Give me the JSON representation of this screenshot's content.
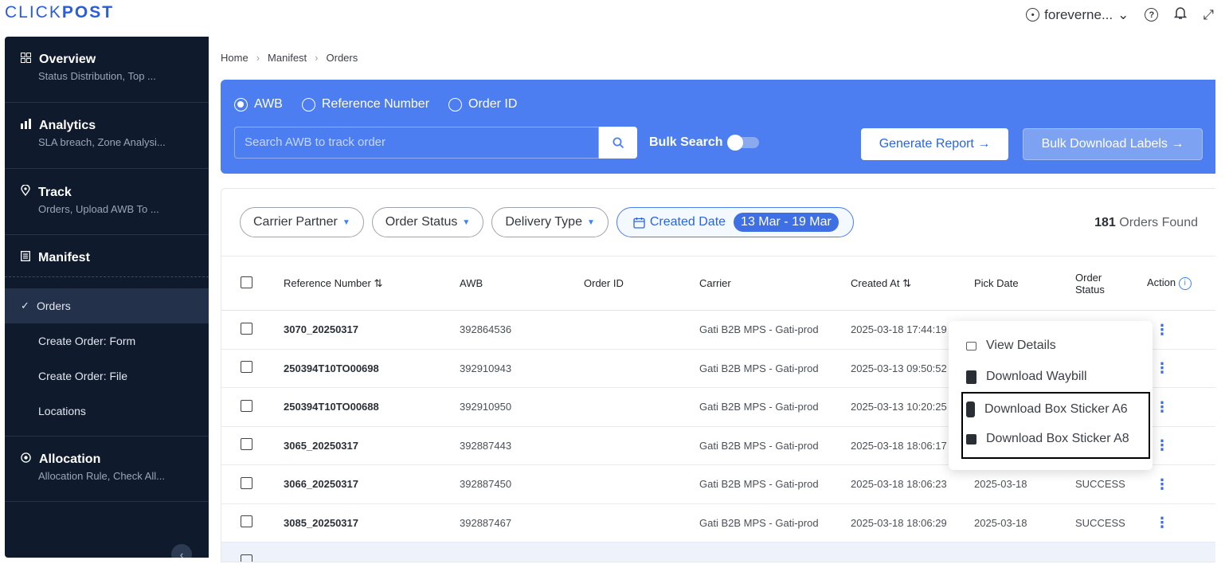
{
  "brand": {
    "part1": "CLICK",
    "part2": "POST"
  },
  "topbar": {
    "username": "foreverne...",
    "caret": "⌄",
    "help": "?",
    "bell": "🔔",
    "expand": "⤢"
  },
  "sidebar": {
    "sections": [
      {
        "title": "Overview",
        "sub": "Status Distribution, Top ..."
      },
      {
        "title": "Analytics",
        "sub": "SLA breach, Zone Analysi..."
      },
      {
        "title": "Track",
        "sub": "Orders, Upload AWB To ..."
      },
      {
        "title": "Manifest"
      },
      {
        "title": "Allocation",
        "sub": "Allocation Rule, Check All..."
      }
    ],
    "subnav": [
      "Orders",
      "Create Order: Form",
      "Create Order: File",
      "Locations"
    ],
    "collapse": "‹"
  },
  "breadcrumb": [
    "Home",
    "Manifest",
    "Orders"
  ],
  "search": {
    "options": [
      "AWB",
      "Reference Number",
      "Order ID"
    ],
    "selected": "AWB",
    "placeholder": "Search AWB to track order",
    "bulk_label": "Bulk Search",
    "generate_label": "Generate Report →",
    "bulk_download_label": "Bulk Download Labels →"
  },
  "filters": {
    "carrier": "Carrier Partner",
    "status": "Order Status",
    "delivery": "Delivery Type",
    "created": "Created Date",
    "date_range": "13 Mar - 19 Mar"
  },
  "found": {
    "count": "181",
    "label": "Orders Found"
  },
  "table": {
    "headers": {
      "ref": "Reference Number",
      "awb": "AWB",
      "order_id": "Order ID",
      "carrier": "Carrier",
      "created": "Created At",
      "pick": "Pick Date",
      "status_l1": "Order",
      "status_l2": "Status",
      "action": "Action"
    },
    "rows": [
      {
        "ref": "3070_20250317",
        "awb": "392864536",
        "carrier": "Gati B2B MPS - Gati-prod",
        "created": "2025-03-18 17:44:19",
        "pick": "",
        "status": ""
      },
      {
        "ref": "250394T10TO00698",
        "awb": "392910943",
        "carrier": "Gati B2B MPS - Gati-prod",
        "created": "2025-03-13 09:50:52",
        "pick": "",
        "status": ""
      },
      {
        "ref": "250394T10TO00688",
        "awb": "392910950",
        "carrier": "Gati B2B MPS - Gati-prod",
        "created": "2025-03-13 10:20:25",
        "pick": "",
        "status": ""
      },
      {
        "ref": "3065_20250317",
        "awb": "392887443",
        "carrier": "Gati B2B MPS - Gati-prod",
        "created": "2025-03-18 18:06:17",
        "pick": "",
        "status": ""
      },
      {
        "ref": "3066_20250317",
        "awb": "392887450",
        "carrier": "Gati B2B MPS - Gati-prod",
        "created": "2025-03-18 18:06:23",
        "pick": "2025-03-18",
        "status": "SUCCESS"
      },
      {
        "ref": "3085_20250317",
        "awb": "392887467",
        "carrier": "Gati B2B MPS - Gati-prod",
        "created": "2025-03-18 18:06:29",
        "pick": "2025-03-18",
        "status": "SUCCESS"
      }
    ]
  },
  "action_menu": {
    "items": [
      "View Details",
      "Download Waybill",
      "Download Box Sticker A6",
      "Download Box Sticker A8"
    ]
  }
}
